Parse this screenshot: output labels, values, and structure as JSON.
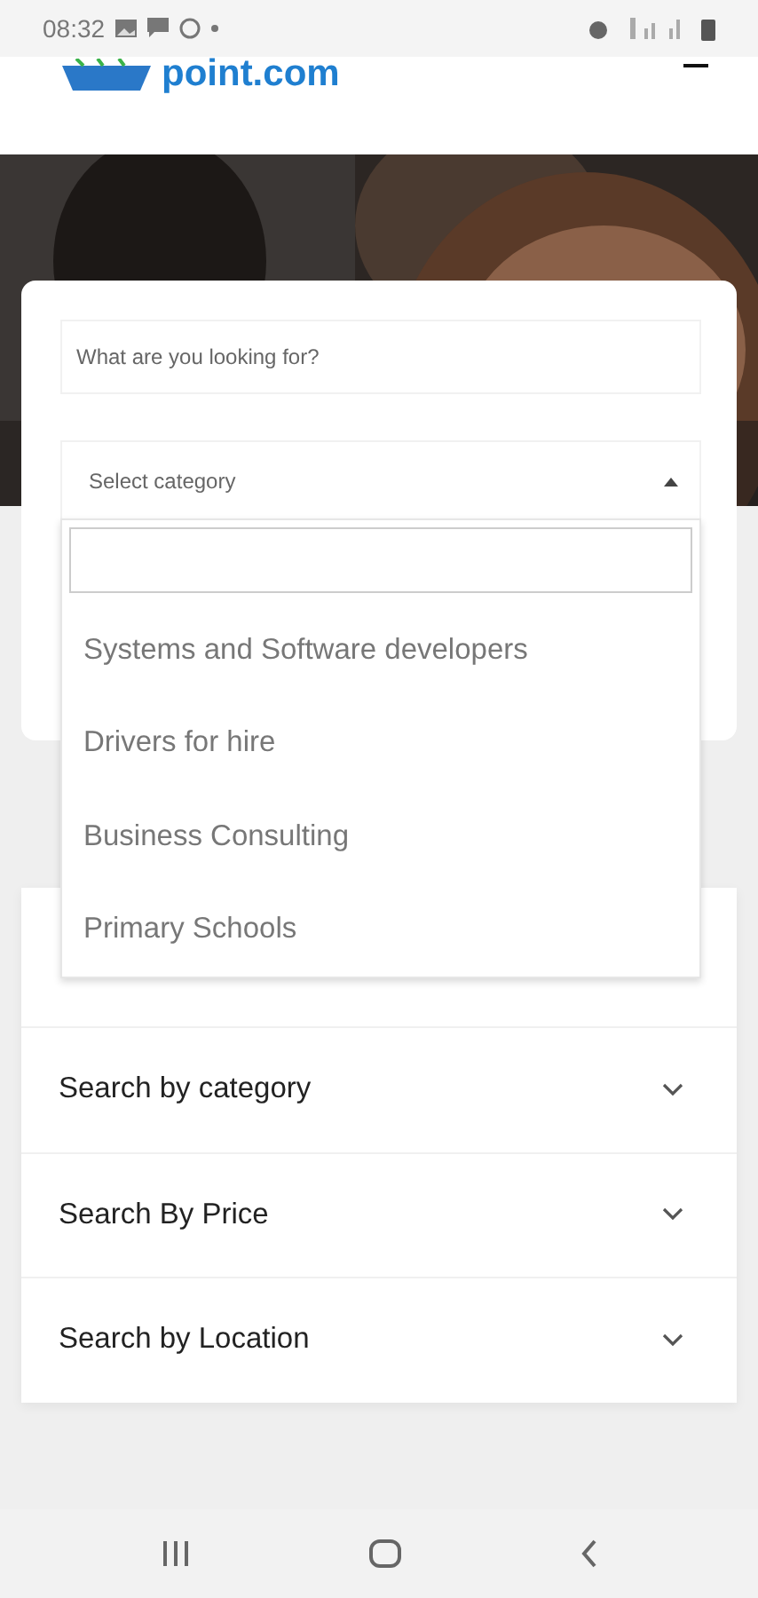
{
  "status_bar": {
    "time": "08:32"
  },
  "header": {
    "logo_text": "point.com"
  },
  "search_card": {
    "query_placeholder": "What are you looking for?",
    "category_select": {
      "placeholder": "Select category",
      "expanded": true,
      "options": [
        "Systems and Software developers",
        "Drivers for hire",
        "Business Consulting",
        "Primary Schools"
      ]
    }
  },
  "filters": [
    {
      "label": "Search by category",
      "expanded": false
    },
    {
      "label": "Search By Price",
      "expanded": false
    },
    {
      "label": "Search by Location",
      "expanded": false
    }
  ]
}
